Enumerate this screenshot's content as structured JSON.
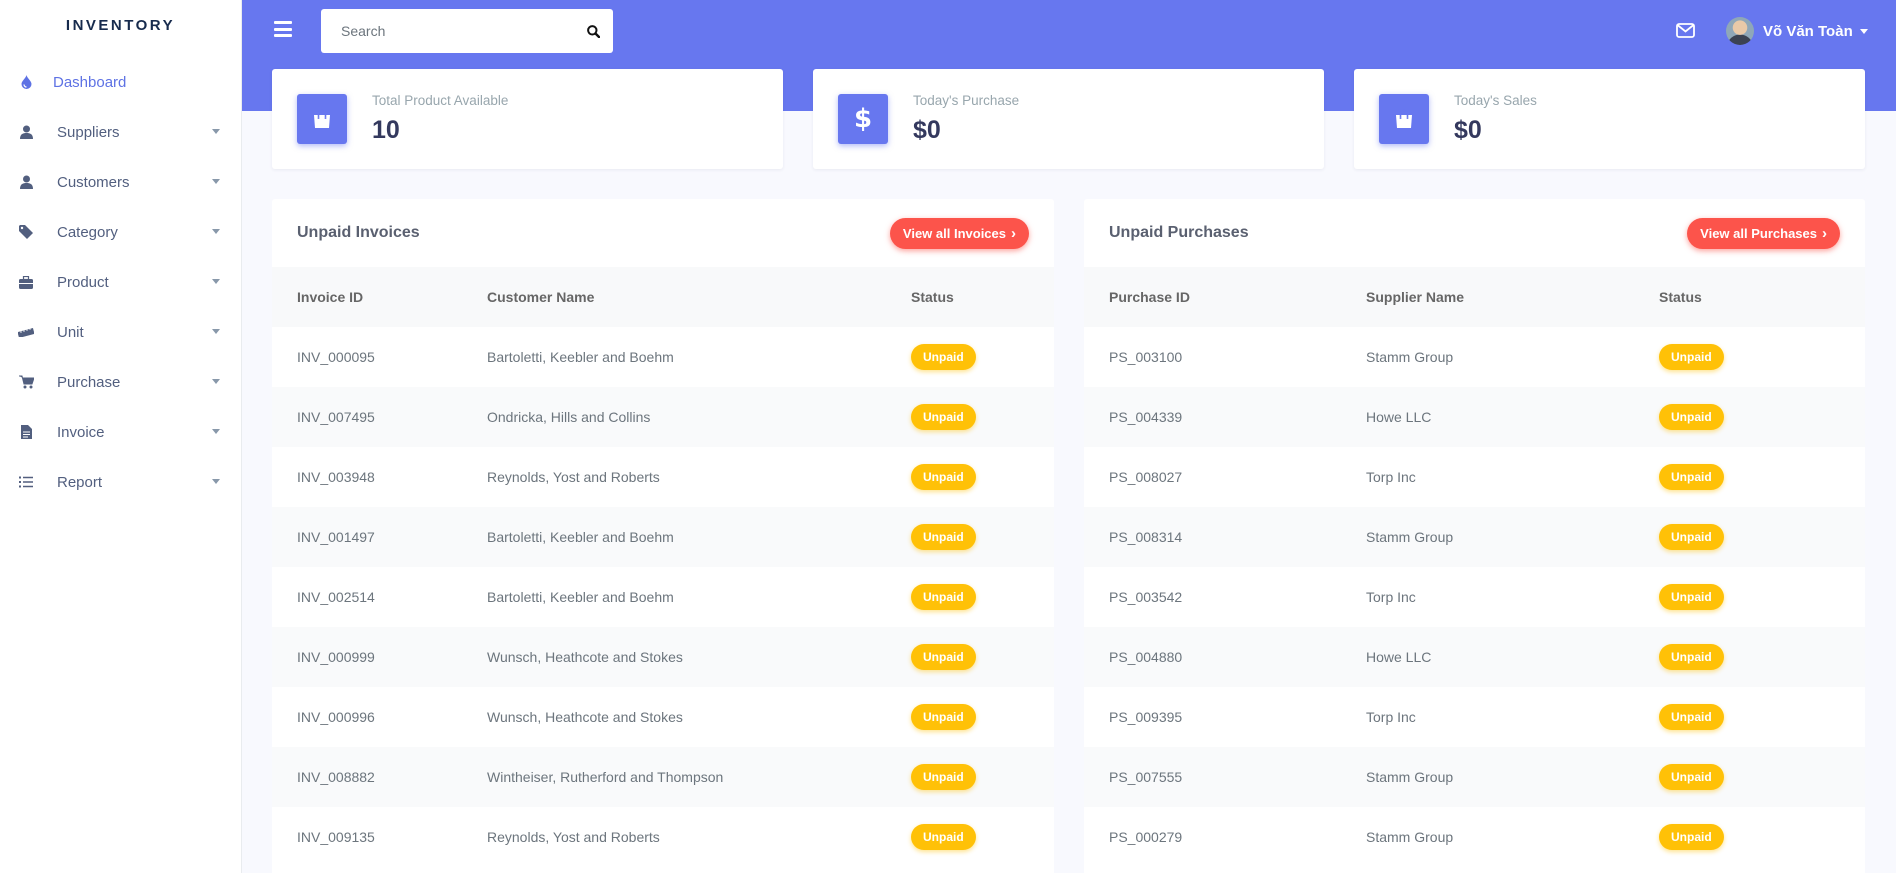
{
  "app": {
    "brand": "INVENTORY"
  },
  "sidebar": {
    "items": [
      {
        "label": "Dashboard",
        "icon": "droplet-icon",
        "active": true
      },
      {
        "label": "Suppliers",
        "icon": "user-icon"
      },
      {
        "label": "Customers",
        "icon": "user-icon"
      },
      {
        "label": "Category",
        "icon": "tag-icon"
      },
      {
        "label": "Product",
        "icon": "briefcase-icon"
      },
      {
        "label": "Unit",
        "icon": "ruler-icon"
      },
      {
        "label": "Purchase",
        "icon": "cart-icon"
      },
      {
        "label": "Invoice",
        "icon": "file-icon"
      },
      {
        "label": "Report",
        "icon": "list-icon"
      }
    ]
  },
  "header": {
    "search_placeholder": "Search",
    "user_name": "Võ Văn Toàn"
  },
  "stats": [
    {
      "label": "Total Product Available",
      "value": "10",
      "icon": "shopping-bag-icon"
    },
    {
      "label": "Today's Purchase",
      "value": "$0",
      "icon": "dollar-icon"
    },
    {
      "label": "Today's Sales",
      "value": "$0",
      "icon": "shopping-bag-icon"
    }
  ],
  "invoices": {
    "title": "Unpaid Invoices",
    "button": "View all Invoices",
    "columns": [
      "Invoice ID",
      "Customer Name",
      "Status"
    ],
    "rows": [
      [
        "INV_000095",
        "Bartoletti, Keebler and Boehm",
        "Unpaid"
      ],
      [
        "INV_007495",
        "Ondricka, Hills and Collins",
        "Unpaid"
      ],
      [
        "INV_003948",
        "Reynolds, Yost and Roberts",
        "Unpaid"
      ],
      [
        "INV_001497",
        "Bartoletti, Keebler and Boehm",
        "Unpaid"
      ],
      [
        "INV_002514",
        "Bartoletti, Keebler and Boehm",
        "Unpaid"
      ],
      [
        "INV_000999",
        "Wunsch, Heathcote and Stokes",
        "Unpaid"
      ],
      [
        "INV_000996",
        "Wunsch, Heathcote and Stokes",
        "Unpaid"
      ],
      [
        "INV_008882",
        "Wintheiser, Rutherford and Thompson",
        "Unpaid"
      ],
      [
        "INV_009135",
        "Reynolds, Yost and Roberts",
        "Unpaid"
      ]
    ]
  },
  "purchases": {
    "title": "Unpaid Purchases",
    "button": "View all Purchases",
    "columns": [
      "Purchase ID",
      "Supplier Name",
      "Status"
    ],
    "rows": [
      [
        "PS_003100",
        "Stamm Group",
        "Unpaid"
      ],
      [
        "PS_004339",
        "Howe LLC",
        "Unpaid"
      ],
      [
        "PS_008027",
        "Torp Inc",
        "Unpaid"
      ],
      [
        "PS_008314",
        "Stamm Group",
        "Unpaid"
      ],
      [
        "PS_003542",
        "Torp Inc",
        "Unpaid"
      ],
      [
        "PS_004880",
        "Howe LLC",
        "Unpaid"
      ],
      [
        "PS_009395",
        "Torp Inc",
        "Unpaid"
      ],
      [
        "PS_007555",
        "Stamm Group",
        "Unpaid"
      ],
      [
        "PS_000279",
        "Stamm Group",
        "Unpaid"
      ]
    ]
  },
  "colors": {
    "primary": "#6777ef",
    "danger": "#fc544b",
    "warning": "#ffc107"
  }
}
